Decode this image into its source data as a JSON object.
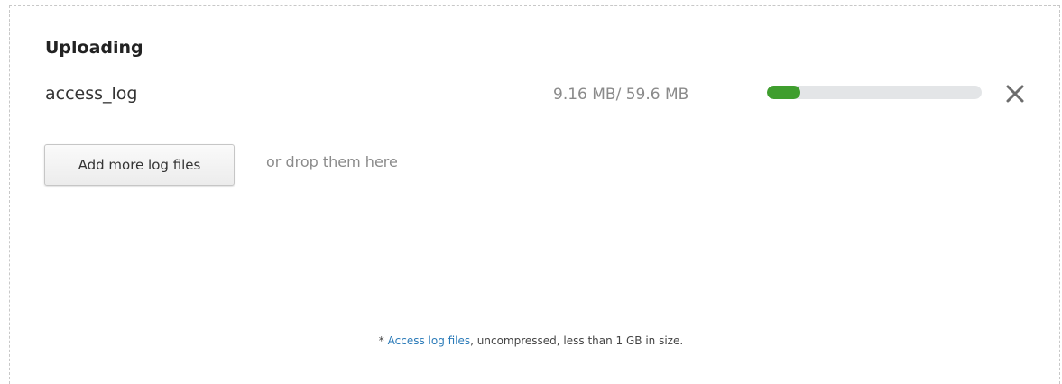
{
  "upload": {
    "title": "Uploading",
    "file": {
      "name": "access_log",
      "size_text": "9.16 MB/ 59.6 MB",
      "uploaded_mb": 9.16,
      "total_mb": 59.6,
      "progress_fraction": 0.154
    },
    "cancel_icon": "close-icon",
    "add_button_label": "Add more log files",
    "drop_hint": "or drop them here",
    "footnote": {
      "prefix": "* ",
      "link_text": "Access log files",
      "suffix": ", uncompressed, less than 1 GB in size."
    }
  },
  "colors": {
    "progress_fill": "#3f9e2e",
    "progress_track": "#e3e5e7",
    "link": "#2a7ab8"
  }
}
